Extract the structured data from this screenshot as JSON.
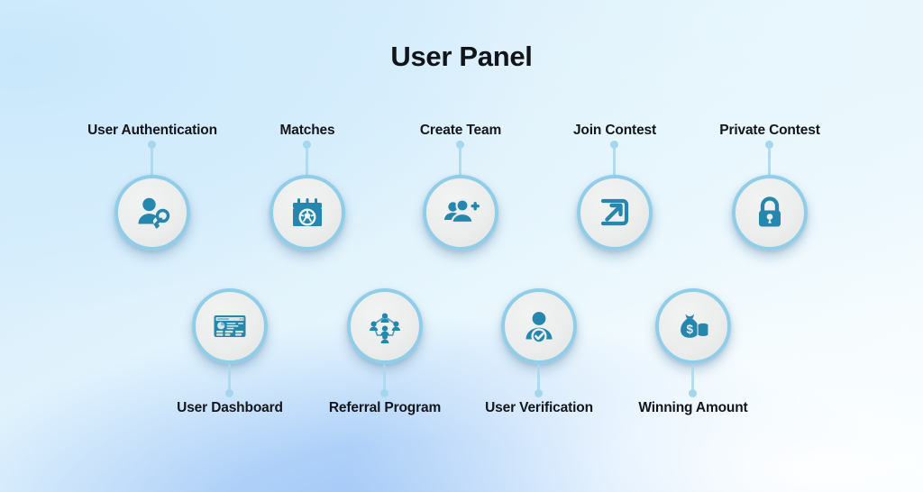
{
  "page": {
    "title": "User Panel",
    "background_colors": {
      "top_left": "#cbe8fb",
      "bottom_center": "#a3c9f7",
      "bottom_right": "#fbfeff",
      "top_right": "#e9f7fd"
    },
    "accent_colors": {
      "icon_blue": "#2587ae",
      "ring_blue": "#8fcde9",
      "circle_fill": "#eceded",
      "label_text": "#13161b",
      "title_text": "#111418",
      "connector": "#a8d8ee"
    }
  },
  "top_row": [
    {
      "label": "User Authentication",
      "icon": "user-key-icon"
    },
    {
      "label": "Matches",
      "icon": "calendar-soccer-ball-icon"
    },
    {
      "label": "Create Team",
      "icon": "add-users-icon"
    },
    {
      "label": "Join Contest",
      "icon": "arrow-enter-square-icon"
    },
    {
      "label": "Private Contest",
      "icon": "padlock-icon"
    }
  ],
  "bottom_row": [
    {
      "label": "User Dashboard",
      "icon": "dashboard-window-icon"
    },
    {
      "label": "Referral Program",
      "icon": "network-people-icon"
    },
    {
      "label": "User Verification",
      "icon": "user-check-badge-icon"
    },
    {
      "label": "Winning Amount",
      "icon": "money-bag-coins-icon"
    }
  ]
}
